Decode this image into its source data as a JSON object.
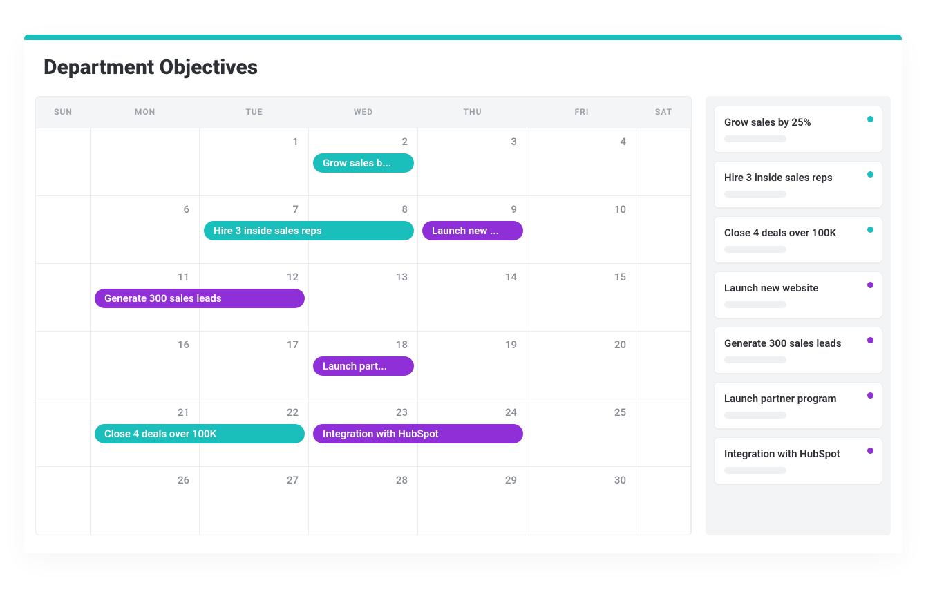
{
  "title": "Department Objectives",
  "colors": {
    "teal": "#1abfbb",
    "purple": "#8f2fd7"
  },
  "dayHeaders": [
    "SUN",
    "MON",
    "TUE",
    "WED",
    "THU",
    "FRI",
    "SAT"
  ],
  "weeks": [
    {
      "days": [
        "",
        "1",
        "2",
        "3",
        "4",
        ""
      ]
    },
    {
      "days": [
        "6",
        "7",
        "8",
        "9",
        "10",
        ""
      ]
    },
    {
      "days": [
        "11",
        "12",
        "13",
        "14",
        "15",
        ""
      ]
    },
    {
      "days": [
        "16",
        "17",
        "18",
        "19",
        "20",
        ""
      ]
    },
    {
      "days": [
        "21",
        "22",
        "23",
        "24",
        "25",
        ""
      ]
    },
    {
      "days": [
        "26",
        "27",
        "28",
        "29",
        "30",
        ""
      ]
    }
  ],
  "events": [
    {
      "label": "Grow sales b...",
      "color": "teal",
      "week": 0,
      "startCol": 3,
      "endCol": 3
    },
    {
      "label": "Hire 3 inside sales reps",
      "color": "teal",
      "week": 1,
      "startCol": 2,
      "endCol": 3
    },
    {
      "label": "Launch new ...",
      "color": "purple",
      "week": 1,
      "startCol": 4,
      "endCol": 4
    },
    {
      "label": "Generate 300 sales leads",
      "color": "purple",
      "week": 2,
      "startCol": 1,
      "endCol": 2
    },
    {
      "label": "Launch part...",
      "color": "purple",
      "week": 3,
      "startCol": 3,
      "endCol": 3
    },
    {
      "label": "Close 4 deals over 100K",
      "color": "teal",
      "week": 4,
      "startCol": 1,
      "endCol": 2
    },
    {
      "label": "Integration with HubSpot",
      "color": "purple",
      "week": 4,
      "startCol": 3,
      "endCol": 4
    }
  ],
  "sidebar": [
    {
      "label": "Grow sales by 25%",
      "color": "teal"
    },
    {
      "label": "Hire 3 inside sales reps",
      "color": "teal"
    },
    {
      "label": "Close 4 deals over 100K",
      "color": "teal"
    },
    {
      "label": "Launch new website",
      "color": "purple"
    },
    {
      "label": "Generate 300 sales leads",
      "color": "purple"
    },
    {
      "label": "Launch partner program",
      "color": "purple"
    },
    {
      "label": "Integration with HubSpot",
      "color": "purple"
    }
  ]
}
